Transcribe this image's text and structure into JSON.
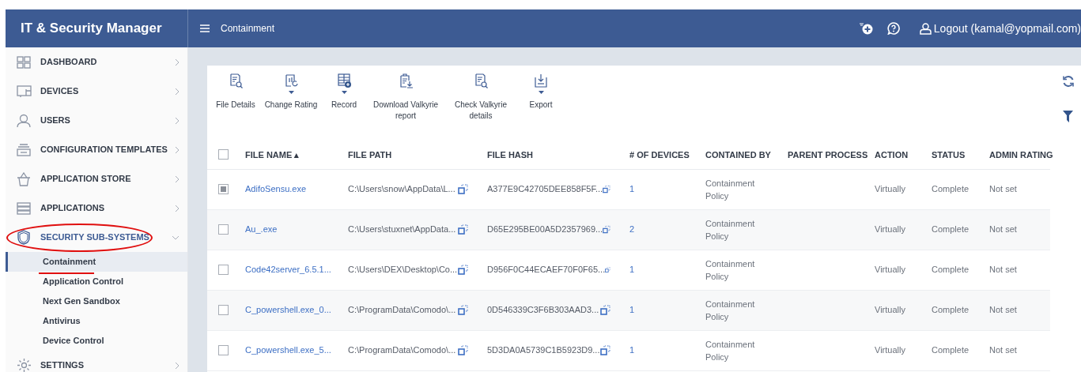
{
  "header": {
    "title": "IT & Security Manager",
    "breadcrumb": "Containment",
    "user": "Logout (kamal@yopmail.com)"
  },
  "sidebar": {
    "items": [
      {
        "label": "DASHBOARD",
        "expanded": false
      },
      {
        "label": "DEVICES",
        "expanded": false
      },
      {
        "label": "USERS",
        "expanded": false
      },
      {
        "label": "CONFIGURATION TEMPLATES",
        "expanded": false
      },
      {
        "label": "APPLICATION STORE",
        "expanded": false
      },
      {
        "label": "APPLICATIONS",
        "expanded": false
      },
      {
        "label": "SECURITY SUB-SYSTEMS",
        "expanded": true,
        "children": [
          {
            "label": "Containment",
            "selected": true
          },
          {
            "label": "Application Control",
            "selected": false
          },
          {
            "label": "Next Gen Sandbox",
            "selected": false
          },
          {
            "label": "Antivirus",
            "selected": false
          },
          {
            "label": "Device Control",
            "selected": false
          }
        ]
      },
      {
        "label": "SETTINGS",
        "expanded": false
      }
    ]
  },
  "toolbar": [
    {
      "label": "File Details",
      "dropdown": false
    },
    {
      "label": "Change Rating",
      "dropdown": true
    },
    {
      "label": "Record",
      "dropdown": true
    },
    {
      "label": "Download Valkyrie report",
      "dropdown": false
    },
    {
      "label": "Check Valkyrie details",
      "dropdown": false
    },
    {
      "label": "Export",
      "dropdown": true
    }
  ],
  "table": {
    "select_all": {
      "checked": false
    },
    "columns": [
      "FILE NAME ▴",
      "FILE PATH",
      "FILE HASH",
      "# OF DEVICES",
      "CONTAINED BY",
      "PARENT PROCESS",
      "ACTION",
      "STATUS",
      "ADMIN RATING"
    ],
    "rows": [
      {
        "checked": true,
        "file_name": "AdifoSensu.exe",
        "file_path": "C:\\Users\\snow\\AppData\\L...",
        "file_hash": "A377E9C42705DEE858F5F...",
        "devices": "1",
        "contained_by": "Containment Policy",
        "action": "Virtually",
        "status": "Complete",
        "admin_rating": "Not set"
      },
      {
        "checked": false,
        "file_name": "Au_.exe",
        "file_path": "C:\\Users\\stuxnet\\AppData...",
        "file_hash": "D65E295BE00A5D2357969...",
        "devices": "2",
        "contained_by": "Containment Policy",
        "action": "Virtually",
        "status": "Complete",
        "admin_rating": "Not set"
      },
      {
        "checked": false,
        "file_name": "Code42server_6.5.1...",
        "file_path": "C:\\Users\\DEX\\Desktop\\Co...",
        "file_hash": "D956F0C44ECAEF70F0F65...",
        "devices": "1",
        "contained_by": "Containment Policy",
        "action": "Virtually",
        "status": "Complete",
        "admin_rating": "Not set"
      },
      {
        "checked": false,
        "file_name": "C_powershell.exe_0...",
        "file_path": "C:\\ProgramData\\Comodo\\...",
        "file_hash": "0D546339C3F6B303AAD3...",
        "devices": "1",
        "contained_by": "Containment Policy",
        "action": "Virtually",
        "status": "Complete",
        "admin_rating": "Not set"
      },
      {
        "checked": false,
        "file_name": "C_powershell.exe_5...",
        "file_path": "C:\\ProgramData\\Comodo\\...",
        "file_hash": "5D3DA0A5739C1B5923D9...",
        "devices": "1",
        "contained_by": "Containment Policy",
        "action": "Virtually",
        "status": "Complete",
        "admin_rating": "Not set"
      }
    ]
  }
}
